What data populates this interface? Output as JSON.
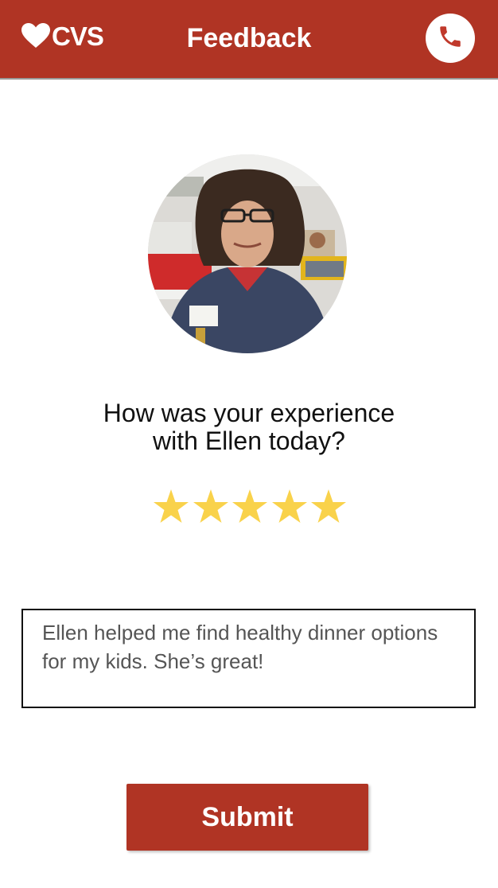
{
  "header": {
    "logo_text": "CVS",
    "logo_icon": "heart-icon",
    "title": "Feedback",
    "call_icon": "phone-icon",
    "brand_color": "#b03424"
  },
  "main": {
    "avatar_alt": "Ellen",
    "question_line1": "How was your experience",
    "question_line2": "with Ellen today?",
    "rating": 5,
    "rating_max": 5,
    "star_color": "#f9d24b",
    "comment": "Ellen helped me find healthy dinner options for my kids. She’s great!",
    "submit_label": "Submit"
  }
}
